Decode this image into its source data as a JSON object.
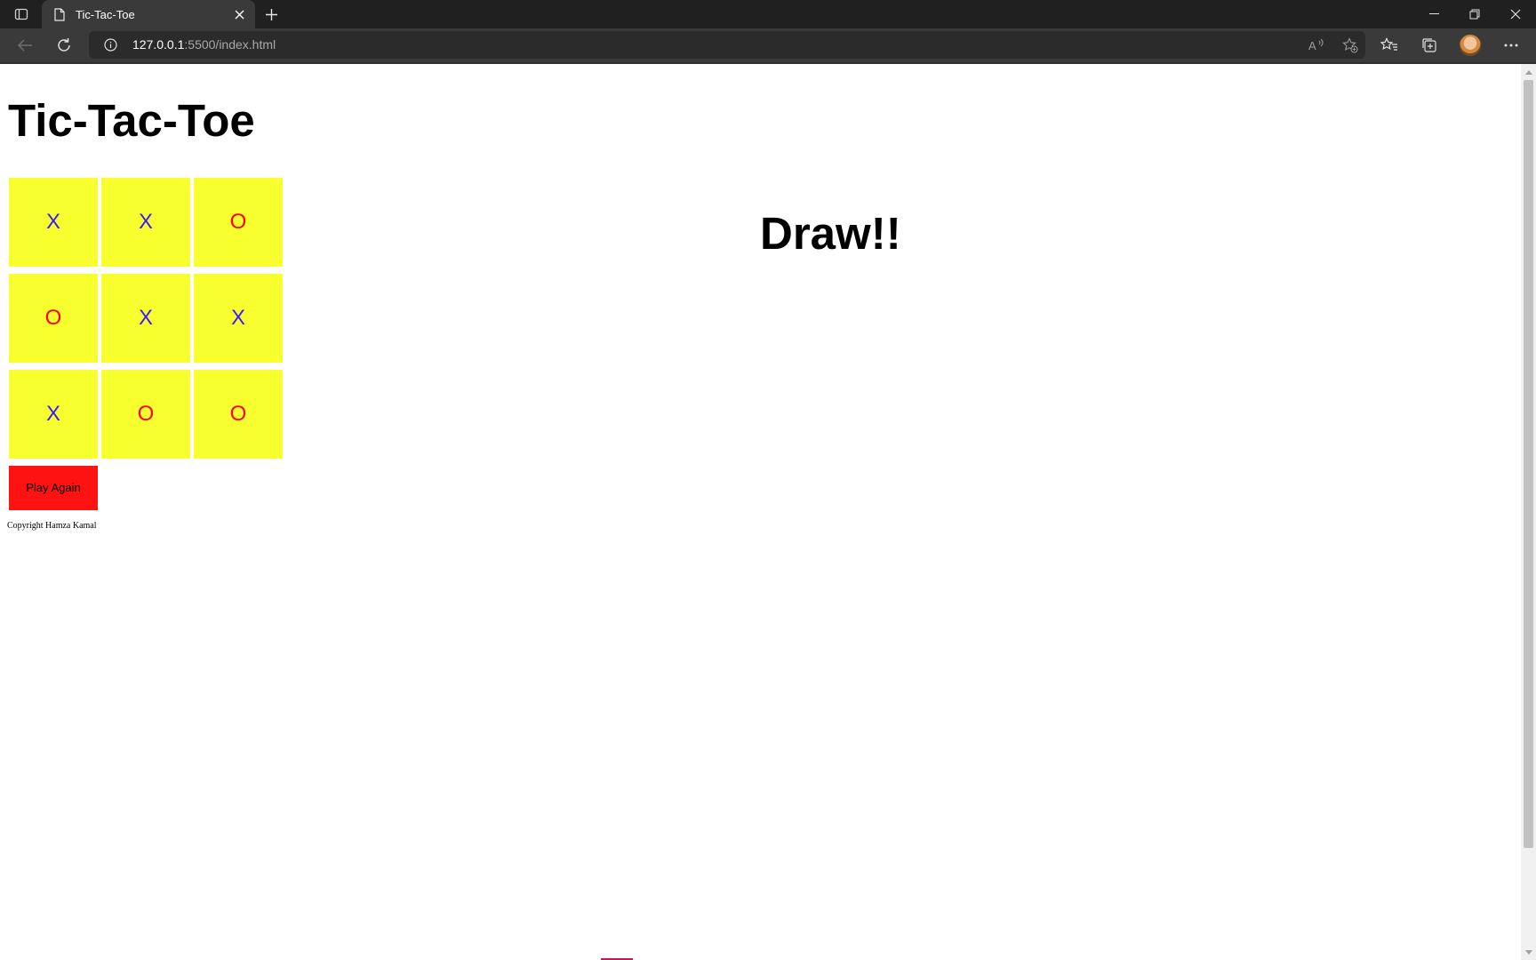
{
  "browser": {
    "tab_title": "Tic-Tac-Toe",
    "url_host": "127.0.0.1",
    "url_rest": ":5500/index.html"
  },
  "page": {
    "title": "Tic-Tac-Toe",
    "result": "Draw!!",
    "play_again_label": "Play Again",
    "copyright": "Copyright Hamza Kamal"
  },
  "board": {
    "cells": [
      "X",
      "X",
      "O",
      "O",
      "X",
      "X",
      "X",
      "O",
      "O"
    ],
    "colors": {
      "X": "#3b1bff",
      "O": "#ff0000",
      "cell_bg": "#f8ff2e",
      "button_bg": "#ff1212"
    }
  }
}
